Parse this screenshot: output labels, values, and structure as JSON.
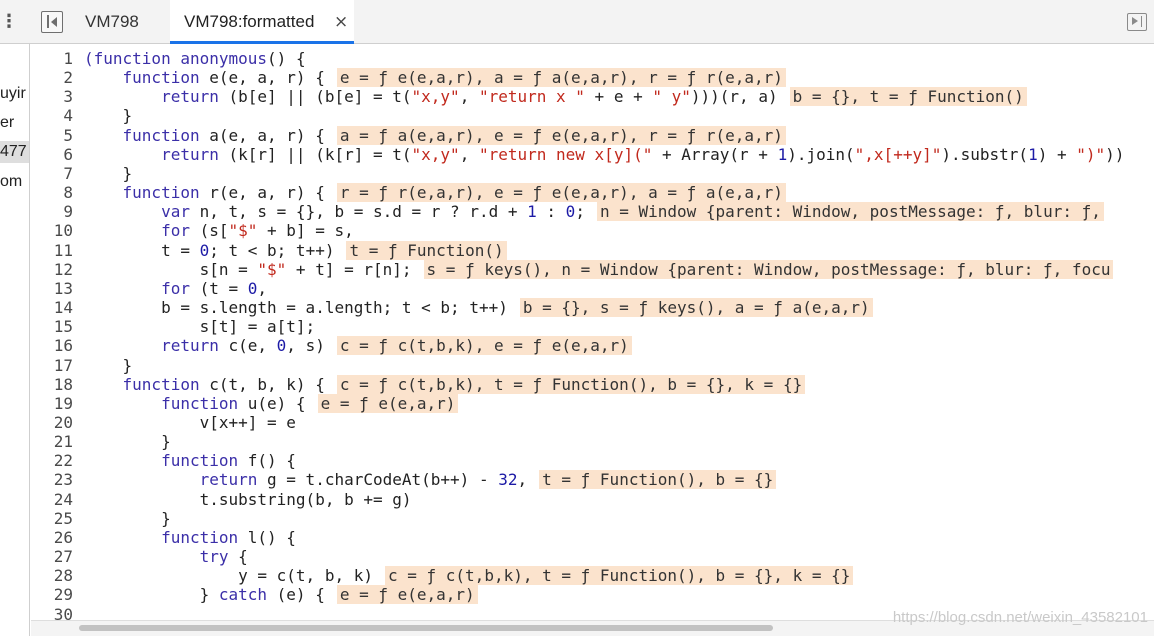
{
  "tabs": [
    {
      "label": "VM798"
    },
    {
      "label": "VM798:formatted",
      "close": "×"
    }
  ],
  "sidebar": {
    "kebab": "⋮",
    "items": [
      "uyir",
      "er",
      "477",
      "om"
    ]
  },
  "line_numbers": [
    "1",
    "2",
    "3",
    "4",
    "5",
    "6",
    "7",
    "8",
    "9",
    "10",
    "11",
    "12",
    "13",
    "14",
    "15",
    "16",
    "17",
    "18",
    "19",
    "20",
    "21",
    "22",
    "23",
    "24",
    "25",
    "26",
    "27",
    "28",
    "29",
    "30"
  ],
  "colors": {
    "keyword": "#3b2fa8",
    "string": "#c1291d",
    "number": "#1c1aa6",
    "inline_value_bg": "#fbe3cd",
    "active_tab_underline": "#1a73e8"
  },
  "code_lines": [
    [
      [
        "k",
        "(function"
      ],
      [
        "t",
        " "
      ],
      [
        "k",
        "anonymous"
      ],
      [
        "t",
        "() {"
      ]
    ],
    [
      [
        "t",
        "    "
      ],
      [
        "k",
        "function"
      ],
      [
        "t",
        " e(e, a, r) {"
      ],
      [
        "v",
        "e = ƒ e(e,a,r), a = ƒ a(e,a,r), r = ƒ r(e,a,r)"
      ]
    ],
    [
      [
        "t",
        "        "
      ],
      [
        "k",
        "return"
      ],
      [
        "t",
        " (b[e] || (b[e] = t("
      ],
      [
        "s",
        "\"x,y\""
      ],
      [
        "t",
        ", "
      ],
      [
        "s",
        "\"return x \""
      ],
      [
        "t",
        " + e + "
      ],
      [
        "s",
        "\" y\""
      ],
      [
        "t",
        ")))(r, a)"
      ],
      [
        "v",
        "b = {}, t = ƒ Function()"
      ]
    ],
    [
      [
        "t",
        "    }"
      ]
    ],
    [
      [
        "t",
        "    "
      ],
      [
        "k",
        "function"
      ],
      [
        "t",
        " a(e, a, r) {"
      ],
      [
        "v",
        "a = ƒ a(e,a,r), e = ƒ e(e,a,r), r = ƒ r(e,a,r)"
      ]
    ],
    [
      [
        "t",
        "        "
      ],
      [
        "k",
        "return"
      ],
      [
        "t",
        " (k[r] || (k[r] = t("
      ],
      [
        "s",
        "\"x,y\""
      ],
      [
        "t",
        ", "
      ],
      [
        "s",
        "\"return new x[y](\""
      ],
      [
        "t",
        " + Array(r + "
      ],
      [
        "n",
        "1"
      ],
      [
        "t",
        ").join("
      ],
      [
        "s",
        "\",x[++y]\""
      ],
      [
        "t",
        ").substr("
      ],
      [
        "n",
        "1"
      ],
      [
        "t",
        ") + "
      ],
      [
        "s",
        "\")\""
      ],
      [
        "t",
        "))"
      ]
    ],
    [
      [
        "t",
        "    }"
      ]
    ],
    [
      [
        "t",
        "    "
      ],
      [
        "k",
        "function"
      ],
      [
        "t",
        " r(e, a, r) {"
      ],
      [
        "v",
        "r = ƒ r(e,a,r), e = ƒ e(e,a,r), a = ƒ a(e,a,r)"
      ]
    ],
    [
      [
        "t",
        "        "
      ],
      [
        "k",
        "var"
      ],
      [
        "t",
        " n, t, s = {}, b = s.d = r ? r.d + "
      ],
      [
        "n",
        "1"
      ],
      [
        "t",
        " : "
      ],
      [
        "n",
        "0"
      ],
      [
        "t",
        ";"
      ],
      [
        "v",
        "n = Window {parent: Window, postMessage: ƒ, blur: ƒ,"
      ]
    ],
    [
      [
        "t",
        "        "
      ],
      [
        "k",
        "for"
      ],
      [
        "t",
        " (s["
      ],
      [
        "s",
        "\"$\""
      ],
      [
        "t",
        " + b] = s,"
      ]
    ],
    [
      [
        "t",
        "        t = "
      ],
      [
        "n",
        "0"
      ],
      [
        "t",
        "; t < b; t++)"
      ],
      [
        "v",
        "t = ƒ Function()"
      ]
    ],
    [
      [
        "t",
        "            s[n = "
      ],
      [
        "s",
        "\"$\""
      ],
      [
        "t",
        " + t] = r[n];"
      ],
      [
        "v",
        "s = ƒ keys(), n = Window {parent: Window, postMessage: ƒ, blur: ƒ, focu"
      ]
    ],
    [
      [
        "t",
        "        "
      ],
      [
        "k",
        "for"
      ],
      [
        "t",
        " (t = "
      ],
      [
        "n",
        "0"
      ],
      [
        "t",
        ","
      ]
    ],
    [
      [
        "t",
        "        b = s.length = a.length; t < b; t++)"
      ],
      [
        "v",
        "b = {}, s = ƒ keys(), a = ƒ a(e,a,r)"
      ]
    ],
    [
      [
        "t",
        "            s[t] = a[t];"
      ]
    ],
    [
      [
        "t",
        "        "
      ],
      [
        "k",
        "return"
      ],
      [
        "t",
        " c(e, "
      ],
      [
        "n",
        "0"
      ],
      [
        "t",
        ", s)"
      ],
      [
        "v",
        "c = ƒ c(t,b,k), e = ƒ e(e,a,r)"
      ]
    ],
    [
      [
        "t",
        "    }"
      ]
    ],
    [
      [
        "t",
        "    "
      ],
      [
        "k",
        "function"
      ],
      [
        "t",
        " c(t, b, k) {"
      ],
      [
        "v",
        "c = ƒ c(t,b,k), t = ƒ Function(), b = {}, k = {}"
      ]
    ],
    [
      [
        "t",
        "        "
      ],
      [
        "k",
        "function"
      ],
      [
        "t",
        " u(e) {"
      ],
      [
        "v",
        "e = ƒ e(e,a,r)"
      ]
    ],
    [
      [
        "t",
        "            v[x++] = e"
      ]
    ],
    [
      [
        "t",
        "        }"
      ]
    ],
    [
      [
        "t",
        "        "
      ],
      [
        "k",
        "function"
      ],
      [
        "t",
        " f() {"
      ]
    ],
    [
      [
        "t",
        "            "
      ],
      [
        "k",
        "return"
      ],
      [
        "t",
        " g = t.charCodeAt(b++) - "
      ],
      [
        "n",
        "32"
      ],
      [
        "t",
        ","
      ],
      [
        "v",
        "t = ƒ Function(), b = {}"
      ]
    ],
    [
      [
        "t",
        "            t.substring(b, b += g)"
      ]
    ],
    [
      [
        "t",
        "        }"
      ]
    ],
    [
      [
        "t",
        "        "
      ],
      [
        "k",
        "function"
      ],
      [
        "t",
        " l() {"
      ]
    ],
    [
      [
        "t",
        "            "
      ],
      [
        "k",
        "try"
      ],
      [
        "t",
        " {"
      ]
    ],
    [
      [
        "t",
        "                y = c(t, b, k)"
      ],
      [
        "v",
        "c = ƒ c(t,b,k), t = ƒ Function(), b = {}, k = {}"
      ]
    ],
    [
      [
        "t",
        "            } "
      ],
      [
        "k",
        "catch"
      ],
      [
        "t",
        " (e) {"
      ],
      [
        "v",
        "e = ƒ e(e,a,r)"
      ]
    ],
    [
      [
        "t",
        "                "
      ]
    ]
  ],
  "watermark": "https://blog.csdn.net/weixin_43582101"
}
